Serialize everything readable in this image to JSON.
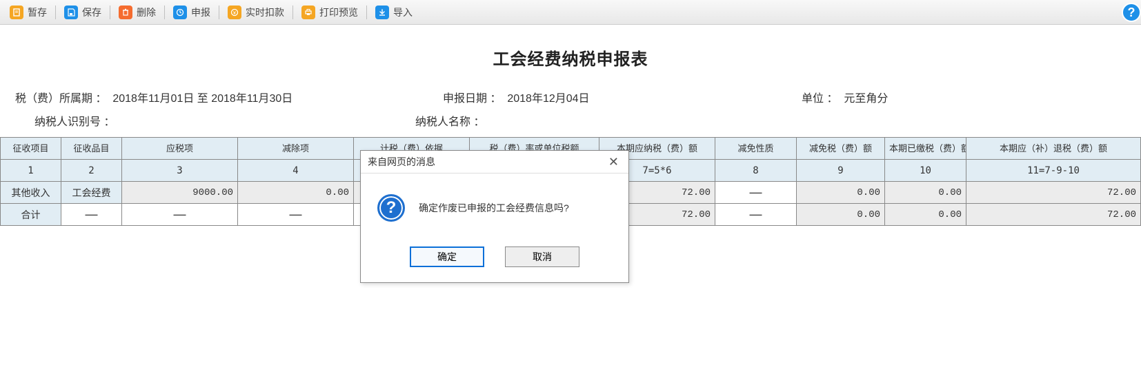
{
  "toolbar": {
    "stash": "暂存",
    "save": "保存",
    "delete": "删除",
    "declare": "申报",
    "realtime_deduct": "实时扣款",
    "print_preview": "打印预览",
    "import": "导入"
  },
  "title": "工会经费纳税申报表",
  "meta": {
    "period_label": "税（费）所属期 ：",
    "period_value": "2018年11月01日 至 2018年11月30日",
    "taxpayer_id_label": "纳税人识别号 ：",
    "taxpayer_id_value": "",
    "declare_date_label": "申报日期 ：",
    "declare_date_value": "2018年12月04日",
    "taxpayer_name_label": "纳税人名称 ：",
    "taxpayer_name_value": "",
    "unit_label": "单位 ：",
    "unit_value": "元至角分"
  },
  "headers": {
    "c1": "征收项目",
    "c2": "征收品目",
    "c3": "应税项",
    "c4": "减除项",
    "c5": "计税（费）依据",
    "c6": "税（费）率或单位税额",
    "c7": "本期应纳税（费）额",
    "c8": "减免性质",
    "c9": "减免税（费）额",
    "c10": "本期已缴税（费）额",
    "c11": "本期应（补）退税（费）额"
  },
  "formula": {
    "c1": "1",
    "c2": "2",
    "c3": "3",
    "c4": "4",
    "c7": "7=5*6",
    "c8": "8",
    "c9": "9",
    "c10": "10",
    "c11": "11=7-9-10"
  },
  "rows": [
    {
      "c1": "其他收入",
      "c2": "工会经费",
      "c3": "9000.00",
      "c4": "0.00",
      "c7": "72.00",
      "c8": "—",
      "c9": "0.00",
      "c10": "0.00",
      "c11": "72.00"
    },
    {
      "c1": "合计",
      "c2": "—",
      "c3": "—",
      "c4": "—",
      "c7": "72.00",
      "c8": "—",
      "c9": "0.00",
      "c10": "0.00",
      "c11": "72.00"
    }
  ],
  "modal": {
    "title": "来自网页的消息",
    "message": "确定作废已申报的工会经费信息吗?",
    "ok": "确定",
    "cancel": "取消"
  },
  "help_symbol": "?"
}
